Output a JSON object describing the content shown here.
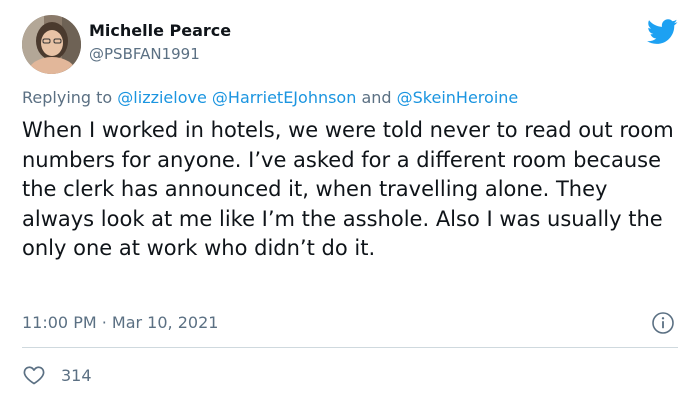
{
  "author": {
    "name": "Michelle Pearce",
    "handle": "@PSBFAN1991",
    "avatar_icon": "avatar-photo"
  },
  "reply": {
    "prefix": "Replying to ",
    "mention_1": "@lizzielove",
    "space_1": " ",
    "mention_2": "@HarrietEJohnson",
    "conjunction": " and ",
    "mention_3": "@SkeinHeroine"
  },
  "tweet": {
    "text": "When I worked in hotels, we were told never to read out room numbers for anyone. I’ve asked for a different room because the clerk has announced it, when travelling alone. They always look at me like I’m the asshole. Also I was usually the only one at work who didn’t do it."
  },
  "meta": {
    "timestamp": "11:00 PM · Mar 10, 2021"
  },
  "actions": {
    "like_count": "314",
    "like_icon": "heart-icon",
    "info_icon": "info-icon",
    "brand_icon": "twitter-bird-icon"
  },
  "colors": {
    "brand": "#1da1f2",
    "link": "#1b95e0",
    "secondary_text": "#5b7083",
    "primary_text": "#0f1419",
    "divider": "#cfd9de"
  }
}
